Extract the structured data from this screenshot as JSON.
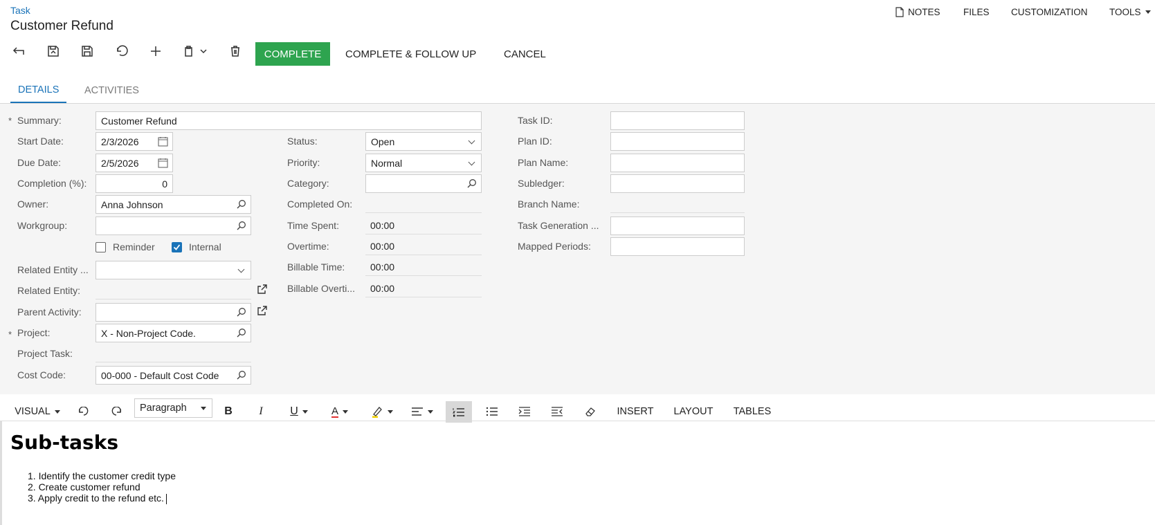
{
  "breadcrumb": "Task",
  "page_title": "Customer Refund",
  "top_menu": {
    "notes": "NOTES",
    "files": "FILES",
    "customization": "CUSTOMIZATION",
    "tools": "TOOLS"
  },
  "toolbar": {
    "icons": [
      "back-icon",
      "save-close-icon",
      "save-icon",
      "undo-icon",
      "add-icon",
      "copy-paste-icon",
      "delete-icon"
    ],
    "complete": "COMPLETE",
    "complete_follow_up": "COMPLETE & FOLLOW UP",
    "cancel": "CANCEL"
  },
  "tabs": {
    "details": "DETAILS",
    "activities": "ACTIVITIES"
  },
  "form": {
    "summary": {
      "label": "Summary:",
      "value": "Customer Refund",
      "required_mark": "*"
    },
    "start_date": {
      "label": "Start Date:",
      "value": "2/3/2026"
    },
    "due_date": {
      "label": "Due Date:",
      "value": "2/5/2026"
    },
    "completion": {
      "label": "Completion (%):",
      "value": "0"
    },
    "owner": {
      "label": "Owner:",
      "value": "Anna Johnson"
    },
    "workgroup": {
      "label": "Workgroup:",
      "value": ""
    },
    "reminder": {
      "label": "Reminder",
      "checked": false
    },
    "internal": {
      "label": "Internal",
      "checked": true
    },
    "related_entity_type": {
      "label": "Related Entity ...",
      "value": ""
    },
    "related_entity": {
      "label": "Related Entity:",
      "value": ""
    },
    "parent_activity": {
      "label": "Parent Activity:",
      "value": ""
    },
    "project": {
      "label": "Project:",
      "value": "X - Non-Project Code.",
      "required_mark": "*"
    },
    "project_task": {
      "label": "Project Task:",
      "value": ""
    },
    "cost_code": {
      "label": "Cost Code:",
      "value": "00-000 - Default Cost Code"
    },
    "status": {
      "label": "Status:",
      "value": "Open"
    },
    "priority": {
      "label": "Priority:",
      "value": "Normal"
    },
    "category": {
      "label": "Category:",
      "value": ""
    },
    "completed_on": {
      "label": "Completed On:",
      "value": ""
    },
    "time_spent": {
      "label": "Time Spent:",
      "value": "00:00"
    },
    "overtime": {
      "label": "Overtime:",
      "value": "00:00"
    },
    "billable_time": {
      "label": "Billable Time:",
      "value": "00:00"
    },
    "billable_overtime": {
      "label": "Billable Overti...",
      "value": "00:00"
    },
    "task_id": {
      "label": "Task ID:",
      "value": ""
    },
    "plan_id": {
      "label": "Plan ID:",
      "value": ""
    },
    "plan_name": {
      "label": "Plan Name:",
      "value": ""
    },
    "subledger": {
      "label": "Subledger:",
      "value": ""
    },
    "branch_name": {
      "label": "Branch Name:",
      "value": ""
    },
    "task_generation": {
      "label": "Task Generation ...",
      "value": ""
    },
    "mapped_periods": {
      "label": "Mapped Periods:",
      "value": ""
    }
  },
  "editor": {
    "mode": "VISUAL",
    "paragraph_style": "Paragraph",
    "bold": "B",
    "italic": "I",
    "underline": "U",
    "font_color": "A",
    "insert": "INSERT",
    "layout": "LAYOUT",
    "tables": "TABLES",
    "font_color_hex": "#e03030",
    "highlight_hex": "#f0d000",
    "content": {
      "heading": "Sub-tasks",
      "items": [
        "1. Identify the customer credit type",
        "2. Create customer refund",
        "3. Apply credit to the refund etc."
      ]
    }
  },
  "colors": {
    "accent": "#1a73b8",
    "complete_button": "#2ea44f"
  }
}
